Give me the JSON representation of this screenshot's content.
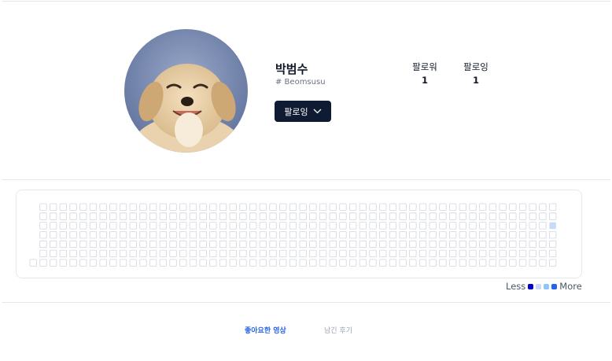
{
  "profile": {
    "name": "박범수",
    "handle": "# Beomsusu",
    "follow_button_label": "팔로잉",
    "stats": [
      {
        "label": "팔로워",
        "value": "1"
      },
      {
        "label": "팔로잉",
        "value": "1"
      }
    ]
  },
  "activity": {
    "weeks": 53,
    "first_week_start_row": 6,
    "highlighted_cells": [
      {
        "week": 52,
        "day": 2,
        "level": 2
      }
    ],
    "legend": {
      "less_label": "Less",
      "more_label": "More",
      "swatch_colors": [
        "#0000c8",
        "#c7dbf8",
        "#93c5fd",
        "#2563eb"
      ]
    },
    "empty_cell_color": "#ffffff",
    "empty_cell_border": "#d1d5db"
  },
  "tabs": [
    {
      "label": "좋아요한 영상",
      "active": true
    },
    {
      "label": "남긴 후기",
      "active": false
    }
  ]
}
